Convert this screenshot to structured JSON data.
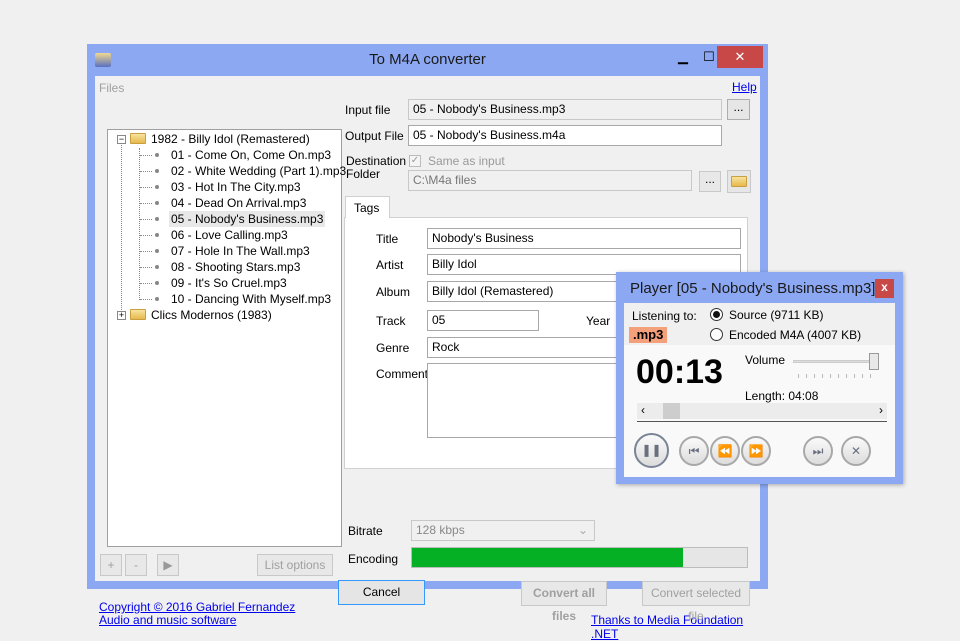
{
  "window": {
    "title": "To M4A converter",
    "minimize": "▁",
    "maximize": "☐",
    "close": "✕"
  },
  "files": {
    "label": "Files",
    "help": "Help",
    "tree": [
      {
        "label": "1982 - Billy Idol (Remastered)",
        "expanded": true,
        "children": [
          "01 - Come On, Come On.mp3",
          "02 - White Wedding (Part 1).mp3",
          "03 - Hot In The City.mp3",
          "04 - Dead On Arrival.mp3",
          "05 - Nobody's Business.mp3",
          "06 - Love Calling.mp3",
          "07 - Hole In The Wall.mp3",
          "08 - Shooting Stars.mp3",
          "09 - It's So Cruel.mp3",
          "10 - Dancing With Myself.mp3"
        ]
      },
      {
        "label": "Clics Modernos (1983)",
        "expanded": false,
        "children": []
      }
    ],
    "selected": "05 - Nobody's Business.mp3",
    "add": "+",
    "remove": "-",
    "play": "▶",
    "list_options": "List options"
  },
  "form": {
    "input_label": "Input file",
    "input_value": "05 - Nobody's Business.mp3",
    "browse": "...",
    "output_label": "Output File",
    "output_value": "05 - Nobody's Business.m4a",
    "dest_label": "Destination Folder",
    "same_as_input": "Same as input",
    "dest_value": "C:\\M4a files",
    "dest_browse": "..."
  },
  "tags": {
    "tab": "Tags",
    "title_label": "Title",
    "title": "Nobody's Business",
    "artist_label": "Artist",
    "artist": "Billy Idol",
    "album_label": "Album",
    "album": "Billy Idol (Remastered)",
    "track_label": "Track",
    "track": "05",
    "year_label": "Year",
    "genre_label": "Genre",
    "genre": "Rock",
    "comment_label": "Comment",
    "comment": ""
  },
  "encoding": {
    "bitrate_label": "Bitrate",
    "bitrate": "128 kbps",
    "encoding_label": "Encoding",
    "progress_percent": 81,
    "progress_color": "#06b025"
  },
  "buttons": {
    "cancel": "Cancel",
    "convert_all": "Convert all files",
    "convert_selected": "Convert selected file"
  },
  "footer": {
    "copyright": "Copyright ©  2016 Gabriel Fernandez",
    "subtitle": "Audio and music software",
    "thanks": "Thanks to Media Foundation .NET"
  },
  "player": {
    "title": "Player [05 - Nobody's Business.mp3]",
    "close": "x",
    "listening_label": "Listening to:",
    "format_badge": ".mp3",
    "badge_color": "#f4a07a",
    "source": "Source (9711 KB)",
    "encoded": "Encoded M4A (4007 KB)",
    "selected": "source",
    "time": "00:13",
    "volume_label": "Volume",
    "volume_percent": 100,
    "length": "Length: 04:08",
    "position_percent": 5
  }
}
